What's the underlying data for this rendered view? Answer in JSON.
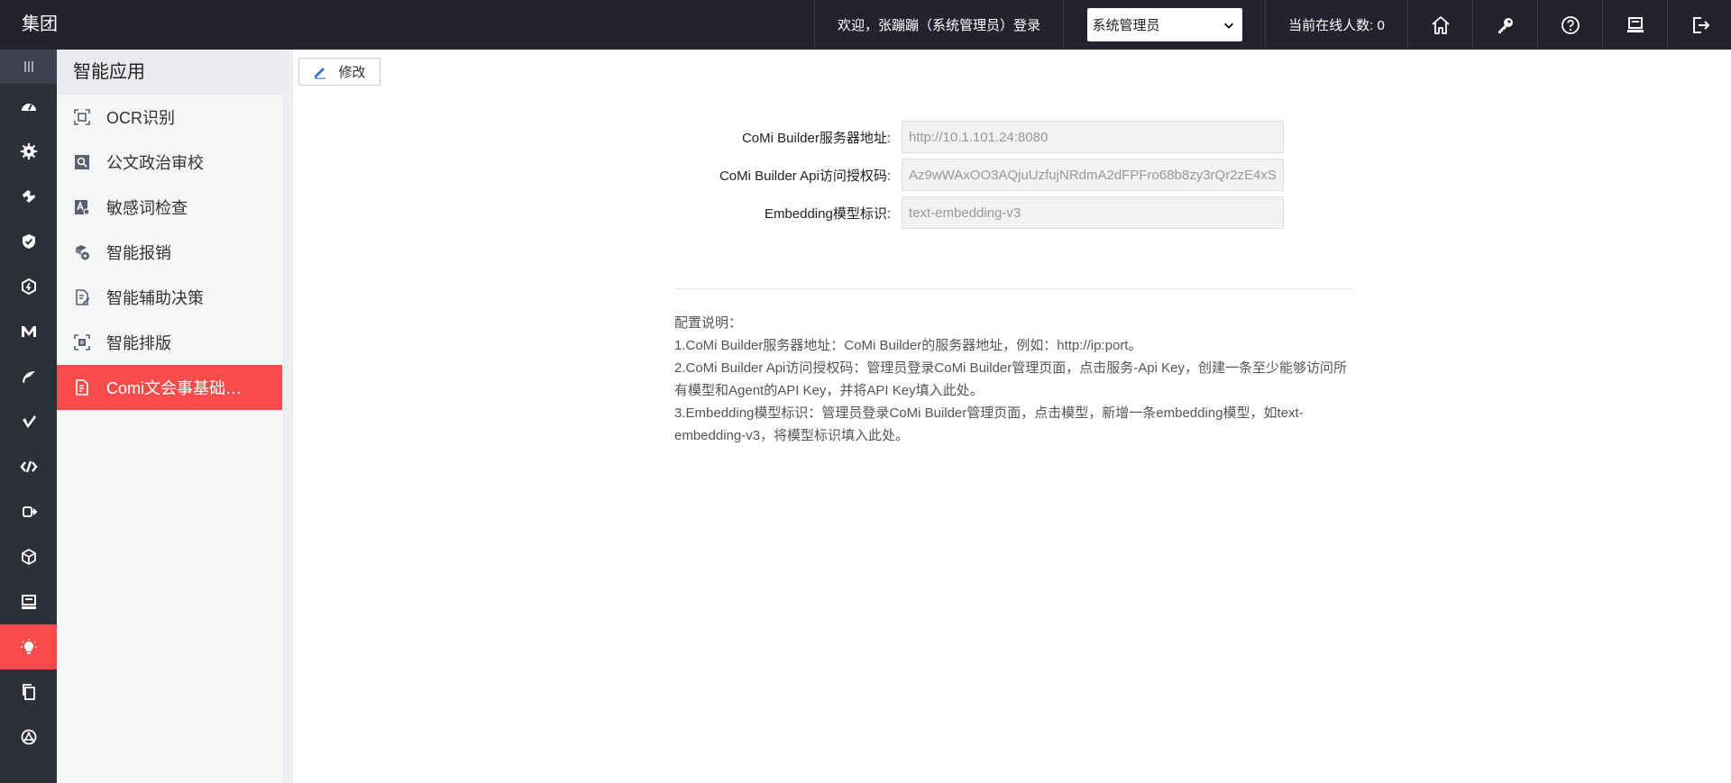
{
  "header": {
    "brand": "集团",
    "welcome": "欢迎，张蹦蹦（系统管理员）登录",
    "role_selected": "系统管理员",
    "online_label": "当前在线人数: 0",
    "icons": [
      "home-icon",
      "key-icon",
      "help-icon",
      "monitor-icon",
      "logout-icon"
    ]
  },
  "rail": {
    "icons": [
      "menu-icon",
      "dashboard-icon",
      "gear-icon",
      "puzzle-icon",
      "shield-icon",
      "hexagon-icon",
      "m-logo-icon",
      "leaf-icon",
      "check-logo-icon",
      "code-icon",
      "flow-icon",
      "cube-icon",
      "desktop-icon",
      "bulb-icon",
      "copy-icon",
      "network-icon"
    ],
    "active_index": 13
  },
  "sidebar": {
    "title": "智能应用",
    "items": [
      {
        "label": "OCR识别",
        "icon": "scan-icon"
      },
      {
        "label": "公文政治审校",
        "icon": "search-doc-icon"
      },
      {
        "label": "敏感词检查",
        "icon": "text-check-icon"
      },
      {
        "label": "智能报销",
        "icon": "coins-icon"
      },
      {
        "label": "智能辅助决策",
        "icon": "doc-edit-icon"
      },
      {
        "label": "智能排版",
        "icon": "layout-icon"
      },
      {
        "label": "Comi文会事基础…",
        "icon": "doc-list-icon",
        "active": true
      }
    ]
  },
  "main": {
    "edit_label": "修改",
    "fields": [
      {
        "label": "CoMi Builder服务器地址:",
        "value": "http://10.1.101.24:8080"
      },
      {
        "label": "CoMi Builder Api访问授权码:",
        "value": "Az9wWAxOO3AQjuUzfujNRdmA2dFPFro68b8zy3rQr2zE4xS"
      },
      {
        "label": "Embedding模型标识:",
        "value": "text-embedding-v3"
      }
    ],
    "notes": [
      "配置说明：",
      "1.CoMi Builder服务器地址：CoMi Builder的服务器地址，例如：http://ip:port。",
      "2.CoMi Builder Api访问授权码：管理员登录CoMi Builder管理页面，点击服务-Api Key，创建一条至少能够访问所有模型和Agent的API Key，并将API Key填入此处。",
      "3.Embedding模型标识：管理员登录CoMi Builder管理页面，点击模型，新增一条embedding模型，如text-embedding-v3，将模型标识填入此处。"
    ]
  },
  "colors": {
    "topbar": "#23232f",
    "rail": "#2e3038",
    "accent": "#f84b4b"
  }
}
